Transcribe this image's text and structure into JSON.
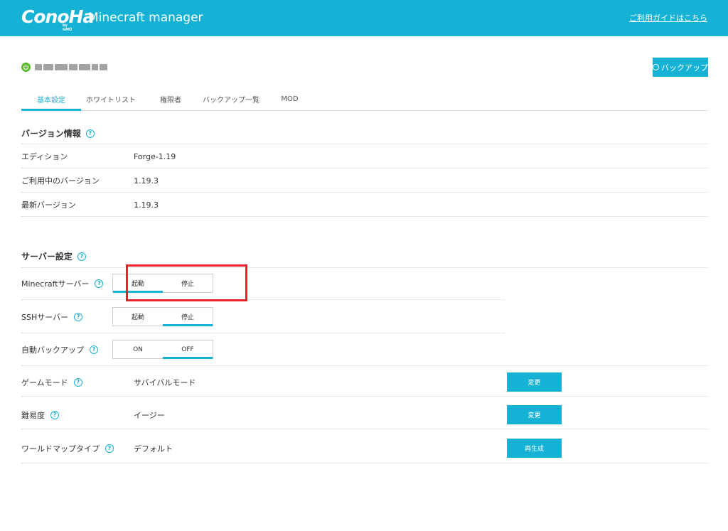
{
  "header": {
    "logo_text": "ConoHa",
    "logo_sub": "by GMO",
    "app_title": "Minecraft manager",
    "guide_link": "ご利用ガイドはこちら",
    "bg_color": "#16b2d6"
  },
  "server": {
    "status_icon": "power-icon",
    "status_color": "#5cb82e"
  },
  "backup_button": {
    "label": "バックアップ",
    "icon": "backup-icon"
  },
  "tabs": [
    {
      "label": "基本設定",
      "active": true
    },
    {
      "label": "ホワイトリスト",
      "active": false
    },
    {
      "label": "権限者",
      "active": false
    },
    {
      "label": "バックアップ一覧",
      "active": false
    },
    {
      "label": "MOD",
      "active": false
    }
  ],
  "version_section": {
    "title": "バージョン情報",
    "help_icon": "?",
    "rows": [
      {
        "label": "エディション",
        "value": "Forge-1.19"
      },
      {
        "label": "ご利用中のバージョン",
        "value": "1.19.3"
      },
      {
        "label": "最新バージョン",
        "value": "1.19.3"
      }
    ]
  },
  "server_section": {
    "title": "サーバー設定",
    "help_icon": "?",
    "minecraft_server": {
      "label": "Minecraftサーバー",
      "option_a": "起動",
      "option_b": "停止",
      "selected": "起動"
    },
    "ssh_server": {
      "label": "SSHサーバー",
      "option_a": "起動",
      "option_b": "停止",
      "selected": "停止"
    },
    "auto_backup": {
      "label": "自動バックアップ",
      "option_a": "ON",
      "option_b": "OFF",
      "selected": "OFF"
    },
    "game_mode": {
      "label": "ゲームモード",
      "value": "サバイバルモード",
      "button": "変更"
    },
    "difficulty": {
      "label": "難易度",
      "value": "イージー",
      "button": "変更"
    },
    "world_map_type": {
      "label": "ワールドマップタイプ",
      "value": "デフォルト",
      "button": "再生成"
    }
  },
  "highlight_color": "#e8202a"
}
